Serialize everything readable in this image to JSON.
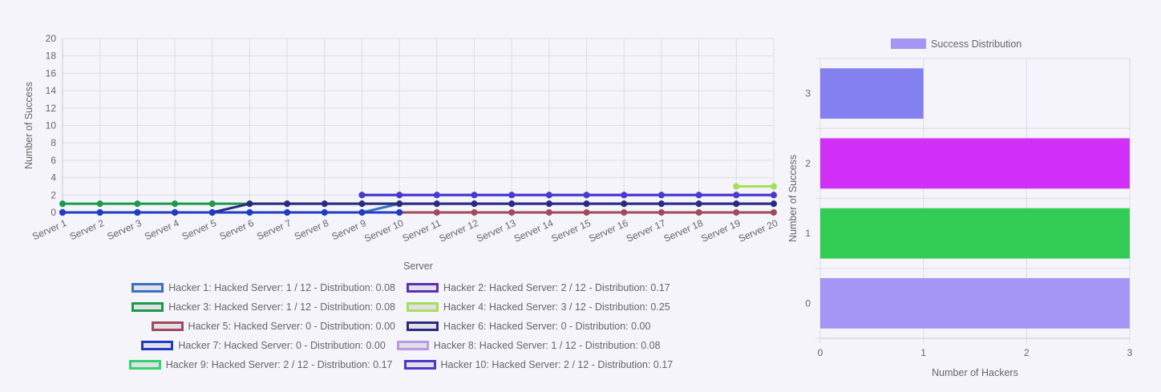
{
  "chart_data": [
    {
      "type": "line",
      "xlabel": "Server",
      "ylabel": "Number of Success",
      "ylim": [
        0,
        20
      ],
      "yticks": [
        0,
        2,
        4,
        6,
        8,
        10,
        12,
        14,
        16,
        18,
        20
      ],
      "categories": [
        "Server 1",
        "Server 2",
        "Server 3",
        "Server 4",
        "Server 5",
        "Server 6",
        "Server 7",
        "Server 8",
        "Server 9",
        "Server 10",
        "Server 11",
        "Server 12",
        "Server 13",
        "Server 14",
        "Server 15",
        "Server 16",
        "Server 17",
        "Server 18",
        "Server 19",
        "Server 20"
      ],
      "grid": true,
      "legend_position": "bottom",
      "series": [
        {
          "name": "Hacker 1: Hacked Server: 1 / 12 - Distribution: 0.08",
          "color": "#3b6fc4",
          "values": [
            0,
            0,
            0,
            0,
            0,
            0,
            0,
            0,
            0,
            1,
            1,
            1,
            1,
            1,
            1,
            1,
            1,
            1,
            1,
            1
          ]
        },
        {
          "name": "Hacker 2: Hacked Server: 2 / 12 - Distribution: 0.17",
          "color": "#5a2fb8",
          "values": [
            null,
            null,
            null,
            null,
            null,
            null,
            null,
            null,
            2,
            2,
            2,
            2,
            2,
            2,
            2,
            2,
            2,
            2,
            2,
            2
          ]
        },
        {
          "name": "Hacker 3: Hacked Server: 1 / 12 - Distribution: 0.08",
          "color": "#1a9a4a",
          "values": [
            1,
            1,
            1,
            1,
            1,
            1,
            1,
            1,
            1,
            1,
            null,
            null,
            null,
            null,
            null,
            null,
            null,
            null,
            null,
            null
          ]
        },
        {
          "name": "Hacker 4: Hacked Server: 3 / 12 - Distribution: 0.25",
          "color": "#a3e05a",
          "values": [
            null,
            null,
            null,
            null,
            null,
            null,
            null,
            null,
            null,
            null,
            null,
            null,
            null,
            null,
            null,
            null,
            null,
            null,
            3,
            3
          ]
        },
        {
          "name": "Hacker 5: Hacked Server: 0 - Distribution: 0.00",
          "color": "#a04a5a",
          "values": [
            null,
            null,
            null,
            null,
            null,
            null,
            null,
            null,
            null,
            0,
            0,
            0,
            0,
            0,
            0,
            0,
            0,
            0,
            0,
            0
          ]
        },
        {
          "name": "Hacker 6: Hacked Server: 0 - Distribution: 0.00",
          "color": "#2a2a80",
          "values": [
            0,
            0,
            0,
            0,
            0,
            1,
            1,
            1,
            1,
            1,
            1,
            1,
            1,
            1,
            1,
            1,
            1,
            1,
            1,
            1
          ]
        },
        {
          "name": "Hacker 7: Hacked Server: 0 - Distribution: 0.00",
          "color": "#1f3cc4",
          "values": [
            0,
            0,
            0,
            0,
            0,
            0,
            0,
            0,
            0,
            0,
            null,
            null,
            null,
            null,
            null,
            null,
            null,
            null,
            null,
            null
          ]
        },
        {
          "name": "Hacker 8: Hacked Server: 1 / 12 - Distribution: 0.08",
          "color": "#b89ae8",
          "values": [
            null,
            null,
            null,
            null,
            null,
            null,
            null,
            null,
            null,
            null,
            null,
            null,
            null,
            null,
            null,
            null,
            null,
            null,
            null,
            null
          ]
        },
        {
          "name": "Hacker 9: Hacked Server: 2 / 12 - Distribution: 0.17",
          "color": "#2ed66a",
          "values": [
            null,
            null,
            null,
            null,
            null,
            null,
            null,
            null,
            null,
            null,
            null,
            null,
            null,
            null,
            null,
            null,
            null,
            null,
            null,
            null
          ]
        },
        {
          "name": "Hacker 10: Hacked Server: 2 / 12 - Distribution: 0.17",
          "color": "#4a3ad0",
          "values": [
            null,
            null,
            null,
            null,
            null,
            null,
            null,
            null,
            2,
            2,
            2,
            2,
            2,
            2,
            2,
            2,
            2,
            2,
            2,
            2
          ]
        }
      ]
    },
    {
      "type": "bar",
      "orientation": "horizontal",
      "xlabel": "Number of Hackers",
      "ylabel": "Number of Success",
      "xlim": [
        0,
        3
      ],
      "xticks": [
        0,
        1,
        2,
        3
      ],
      "categories": [
        "0",
        "1",
        "2",
        "3"
      ],
      "values": [
        3,
        3,
        3,
        1
      ],
      "bar_colors": [
        "#a596f5",
        "#33cc55",
        "#d030f8",
        "#8480f0"
      ],
      "legend": [
        {
          "name": "Success Distribution",
          "color": "#a596f5"
        }
      ],
      "legend_position": "top",
      "grid": true
    }
  ]
}
